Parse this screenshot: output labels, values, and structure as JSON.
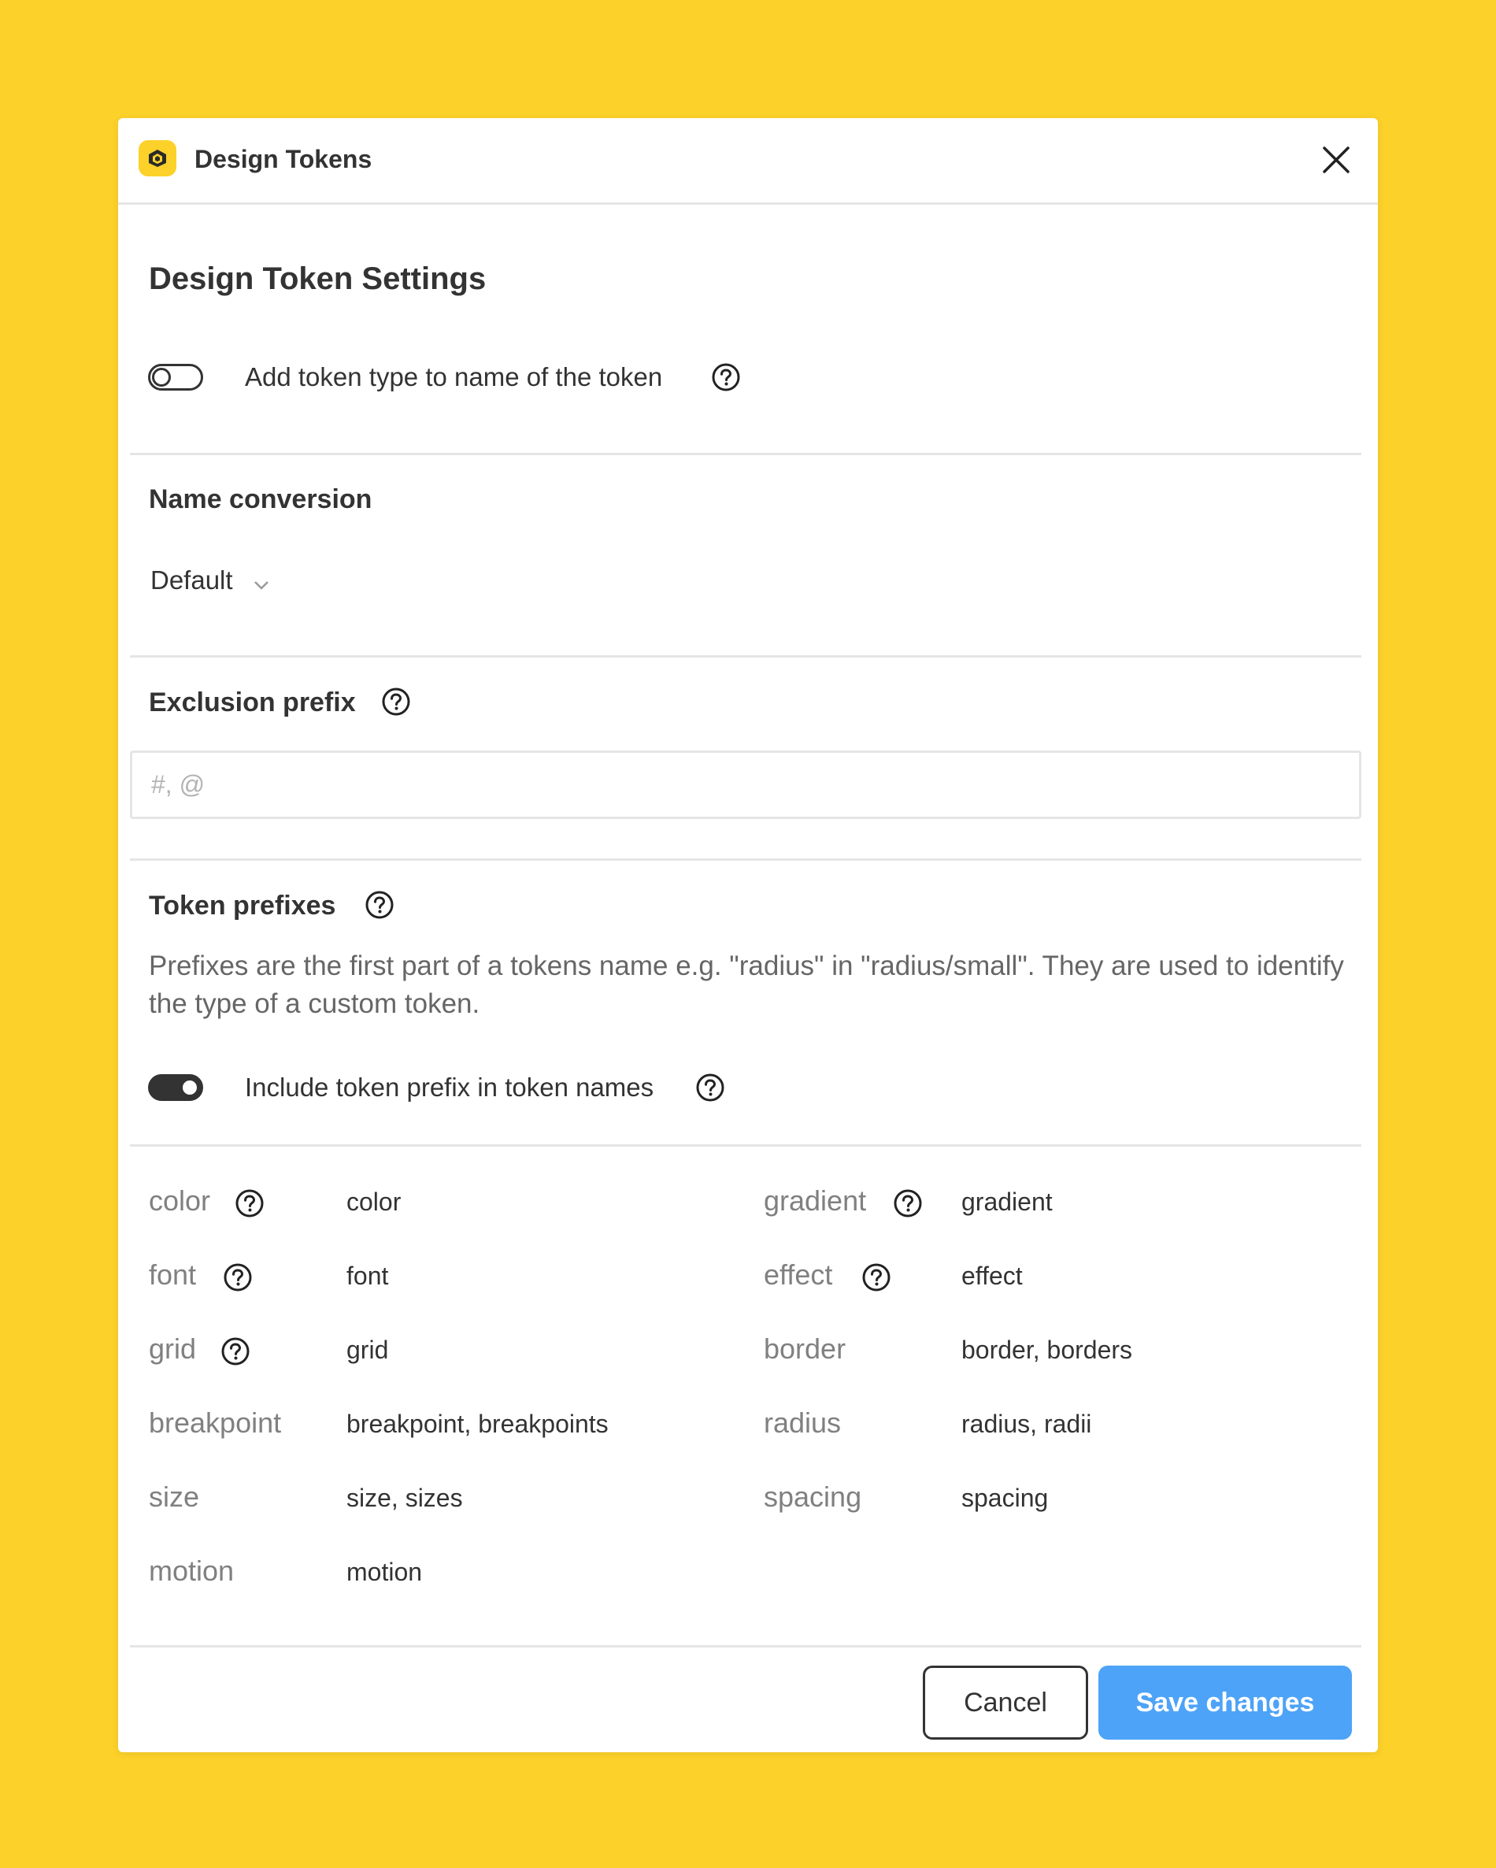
{
  "app": {
    "title": "Design Tokens",
    "icon": "design-tokens-logo-icon"
  },
  "settings": {
    "heading": "Design Token Settings",
    "add_type_toggle": {
      "label": "Add token type to name of the token",
      "on": false
    }
  },
  "name_conversion": {
    "heading": "Name conversion",
    "selected": "Default"
  },
  "exclusion_prefix": {
    "heading": "Exclusion prefix",
    "placeholder": "#, @",
    "value": ""
  },
  "token_prefixes": {
    "heading": "Token prefixes",
    "description": "Prefixes are the first part of a tokens name e.g. \"radius\" in \"radius/small\". They are used to identify the type of a custom token.",
    "include_toggle": {
      "label": "Include token prefix in token names",
      "on": true
    },
    "left": [
      {
        "key": "color",
        "value": "color"
      },
      {
        "key": "font",
        "value": "font"
      },
      {
        "key": "grid",
        "value": "grid"
      },
      {
        "key": "breakpoint",
        "value": "breakpoint, breakpoints"
      },
      {
        "key": "size",
        "value": "size, sizes"
      },
      {
        "key": "motion",
        "value": "motion"
      }
    ],
    "right": [
      {
        "key": "gradient",
        "value": "gradient"
      },
      {
        "key": "effect",
        "value": "effect"
      },
      {
        "key": "border",
        "value": "border, borders"
      },
      {
        "key": "radius",
        "value": "radius, radii"
      },
      {
        "key": "spacing",
        "value": "spacing"
      }
    ]
  },
  "footer": {
    "cancel_label": "Cancel",
    "save_label": "Save changes"
  },
  "colors": {
    "background": "#FCD12A",
    "accent": "#4DA3F7",
    "text": "#333333"
  }
}
